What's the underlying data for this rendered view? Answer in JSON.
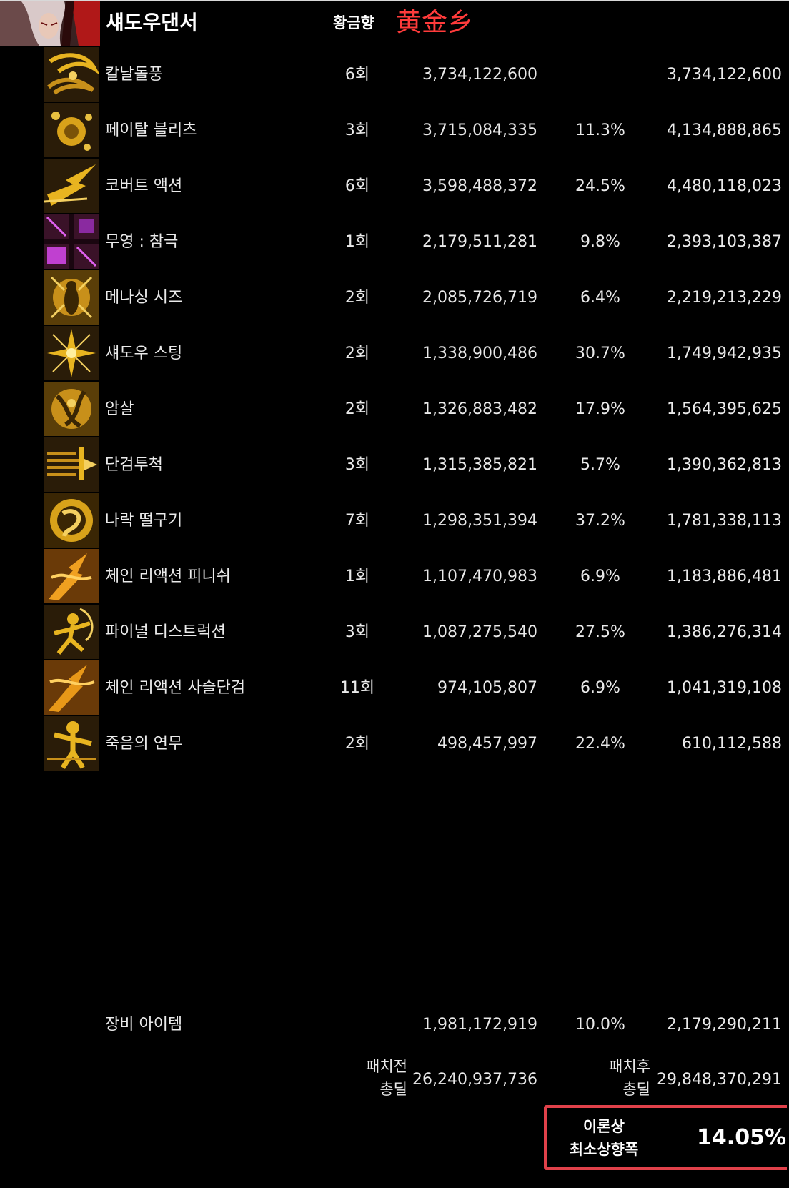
{
  "header": {
    "class_name": "섀도우댄서",
    "guild_label": "황금향",
    "server_name": "黄金乡"
  },
  "skills": [
    {
      "name": "칼날돌풍",
      "icon": "blade-whirl-icon",
      "hits": "6회",
      "before": "3,734,122,600",
      "pct": "",
      "after": "3,734,122,600"
    },
    {
      "name": "페이탈 블리츠",
      "icon": "fatal-blitz-icon",
      "hits": "3회",
      "before": "3,715,084,335",
      "pct": "11.3%",
      "after": "4,134,888,865"
    },
    {
      "name": "코버트 액션",
      "icon": "covert-action-icon",
      "hits": "6회",
      "before": "3,598,488,372",
      "pct": "24.5%",
      "after": "4,480,118,023"
    },
    {
      "name": "무영 : 참극",
      "icon": "shadowless-carnage-icon",
      "hits": "1회",
      "before": "2,179,511,281",
      "pct": "9.8%",
      "after": "2,393,103,387"
    },
    {
      "name": "메나싱 시즈",
      "icon": "menacing-siege-icon",
      "hits": "2회",
      "before": "2,085,726,719",
      "pct": "6.4%",
      "after": "2,219,213,229"
    },
    {
      "name": "섀도우 스팅",
      "icon": "shadow-sting-icon",
      "hits": "2회",
      "before": "1,338,900,486",
      "pct": "30.7%",
      "after": "1,749,942,935"
    },
    {
      "name": "암살",
      "icon": "assassinate-icon",
      "hits": "2회",
      "before": "1,326,883,482",
      "pct": "17.9%",
      "after": "1,564,395,625"
    },
    {
      "name": "단검투척",
      "icon": "dagger-throw-icon",
      "hits": "3회",
      "before": "1,315,385,821",
      "pct": "5.7%",
      "after": "1,390,362,813"
    },
    {
      "name": "나락 떨구기",
      "icon": "abyss-drop-icon",
      "hits": "7회",
      "before": "1,298,351,394",
      "pct": "37.2%",
      "after": "1,781,338,113"
    },
    {
      "name": "체인 리액션 피니쉬",
      "icon": "chain-reaction-finish-icon",
      "hits": "1회",
      "before": "1,107,470,983",
      "pct": "6.9%",
      "after": "1,183,886,481"
    },
    {
      "name": "파이널 디스트럭션",
      "icon": "final-destruction-icon",
      "hits": "3회",
      "before": "1,087,275,540",
      "pct": "27.5%",
      "after": "1,386,276,314"
    },
    {
      "name": "체인 리액션 사슬단검",
      "icon": "chain-reaction-dagger-icon",
      "hits": "11회",
      "before": "974,105,807",
      "pct": "6.9%",
      "after": "1,041,319,108"
    },
    {
      "name": "죽음의 연무",
      "icon": "dance-of-death-icon",
      "hits": "2회",
      "before": "498,457,997",
      "pct": "22.4%",
      "after": "610,112,588"
    }
  ],
  "equipment": {
    "name": "장비 아이템",
    "before": "1,981,172,919",
    "pct": "10.0%",
    "after": "2,179,290,211"
  },
  "totals": {
    "before_label_1": "패치전",
    "before_label_2": "총딜",
    "before_value": "26,240,937,736",
    "after_label_1": "패치후",
    "after_label_2": "총딜",
    "after_value": "29,848,370,291"
  },
  "result": {
    "label_1": "이론상",
    "label_2": "최소상향폭",
    "value": "14.05%",
    "highlight_color": "#e0414a"
  },
  "colors": {
    "background": "#000000",
    "text": "#eaeaea",
    "server_name": "#ff3b3b",
    "icon_gold": "#d8a21a"
  }
}
